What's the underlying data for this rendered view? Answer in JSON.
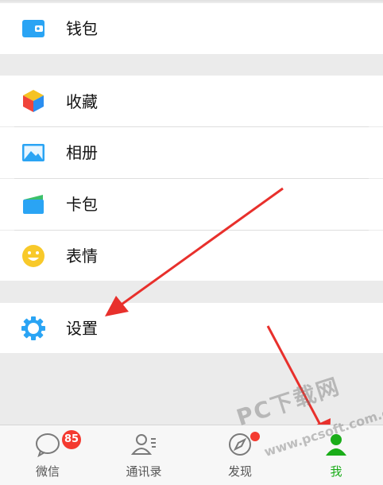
{
  "menu": {
    "wallet": "钱包",
    "favorites": "收藏",
    "album": "相册",
    "cards": "卡包",
    "stickers": "表情",
    "settings": "设置"
  },
  "tabbar": {
    "chats": {
      "label": "微信",
      "badge": "85"
    },
    "contacts": {
      "label": "通讯录"
    },
    "discover": {
      "label": "发现"
    },
    "me": {
      "label": "我"
    }
  },
  "watermark": {
    "line1": "PC下载网",
    "line2": "www.pcsoft.com.cn"
  },
  "colors": {
    "accent_green": "#1aad19",
    "badge_red": "#f43a30",
    "arrow_red": "#e8302c"
  }
}
